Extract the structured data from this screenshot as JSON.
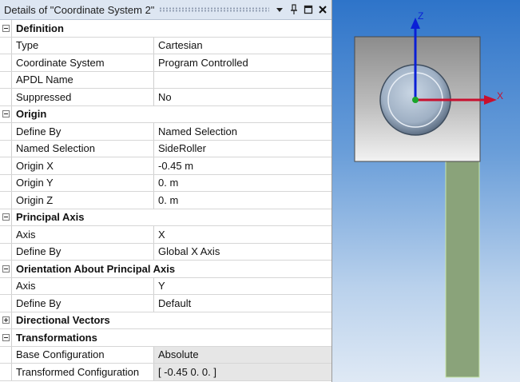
{
  "panel": {
    "title": "Details of \"Coordinate System 2\"",
    "icons": {
      "dropdown": "dropdown-triangle-icon",
      "pin": "pin-icon",
      "restore": "restore-window-icon",
      "close": "close-icon"
    }
  },
  "groups": [
    {
      "label": "Definition",
      "expanded": true,
      "rows": [
        {
          "prop": "Type",
          "value": "Cartesian"
        },
        {
          "prop": "Coordinate System",
          "value": "Program Controlled"
        },
        {
          "prop": "APDL Name",
          "value": ""
        },
        {
          "prop": "Suppressed",
          "value": "No"
        }
      ]
    },
    {
      "label": "Origin",
      "expanded": true,
      "rows": [
        {
          "prop": "Define By",
          "value": "Named Selection"
        },
        {
          "prop": "Named Selection",
          "value": "SideRoller"
        },
        {
          "prop": "Origin X",
          "value": "-0.45 m"
        },
        {
          "prop": "Origin Y",
          "value": "0. m"
        },
        {
          "prop": "Origin Z",
          "value": "0. m"
        }
      ]
    },
    {
      "label": "Principal Axis",
      "expanded": true,
      "rows": [
        {
          "prop": "Axis",
          "value": "X"
        },
        {
          "prop": "Define By",
          "value": "Global X Axis"
        }
      ]
    },
    {
      "label": "Orientation About Principal Axis",
      "expanded": true,
      "rows": [
        {
          "prop": "Axis",
          "value": "Y"
        },
        {
          "prop": "Define By",
          "value": "Default"
        }
      ]
    },
    {
      "label": "Directional Vectors",
      "expanded": false,
      "rows": []
    },
    {
      "label": "Transformations",
      "expanded": true,
      "rows": [
        {
          "prop": "Base Configuration",
          "value": "Absolute",
          "readonly": true
        },
        {
          "prop": "Transformed Configuration",
          "value": "[ -0.45  0.  0. ]",
          "readonly": true
        }
      ]
    }
  ],
  "viewport": {
    "axis_labels": {
      "z": "Z",
      "x": "X"
    },
    "colors": {
      "z_axis": "#0a1fd6",
      "x_axis": "#c8102e",
      "origin": "#1aa52a",
      "plate": "#8aa37a",
      "block_top": "#8c8c8c",
      "block_bottom": "#f2f2f2",
      "roller": "#9fb0c4"
    }
  }
}
